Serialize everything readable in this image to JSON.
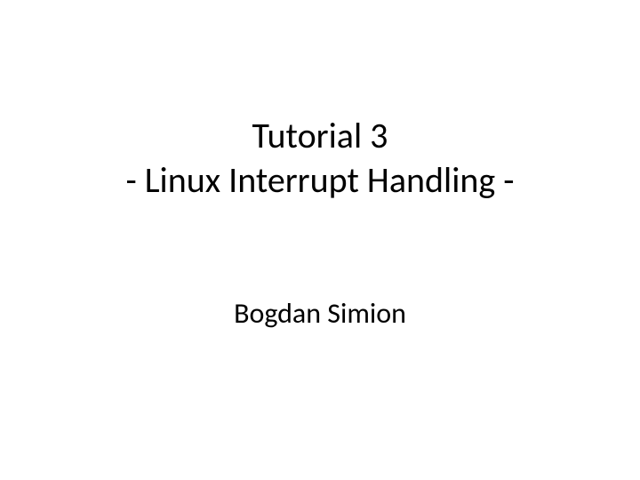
{
  "slide": {
    "title_line_1": "Tutorial 3",
    "title_line_2": "- Linux Interrupt Handling -",
    "author": "Bogdan Simion"
  }
}
